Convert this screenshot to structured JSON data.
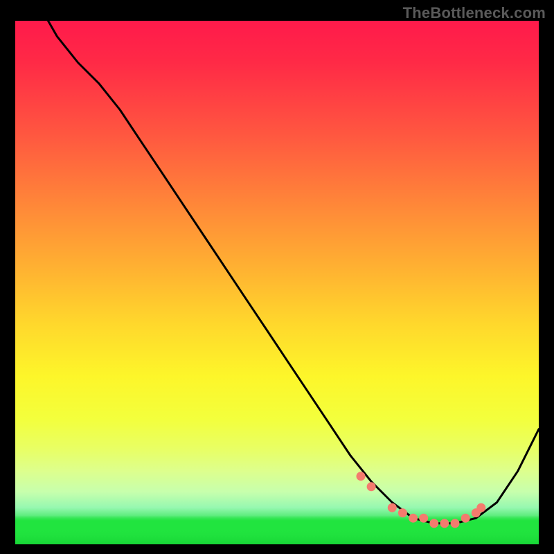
{
  "watermark": "TheBottleneck.com",
  "colors": {
    "curve": "#000000",
    "marker": "#f47b6e",
    "gradient_top": "#ff1a4b",
    "gradient_bottom": "#17d636"
  },
  "chart_data": {
    "type": "line",
    "title": "",
    "xlabel": "",
    "ylabel": "",
    "xlim": [
      0,
      100
    ],
    "ylim": [
      0,
      100
    ],
    "x": [
      0,
      4,
      8,
      12,
      16,
      20,
      24,
      28,
      32,
      36,
      40,
      44,
      48,
      52,
      56,
      60,
      64,
      68,
      72,
      76,
      80,
      84,
      88,
      92,
      96,
      100
    ],
    "y": [
      112,
      104,
      97,
      92,
      88,
      83,
      77,
      71,
      65,
      59,
      53,
      47,
      41,
      35,
      29,
      23,
      17,
      12,
      8,
      5,
      4,
      4,
      5,
      8,
      14,
      22
    ],
    "markers_x": [
      66,
      68,
      72,
      74,
      76,
      78,
      80,
      82,
      84,
      86,
      88,
      89
    ],
    "markers_y": [
      13,
      11,
      7,
      6,
      5,
      5,
      4,
      4,
      4,
      5,
      6,
      7
    ],
    "marker_radius": 6
  }
}
